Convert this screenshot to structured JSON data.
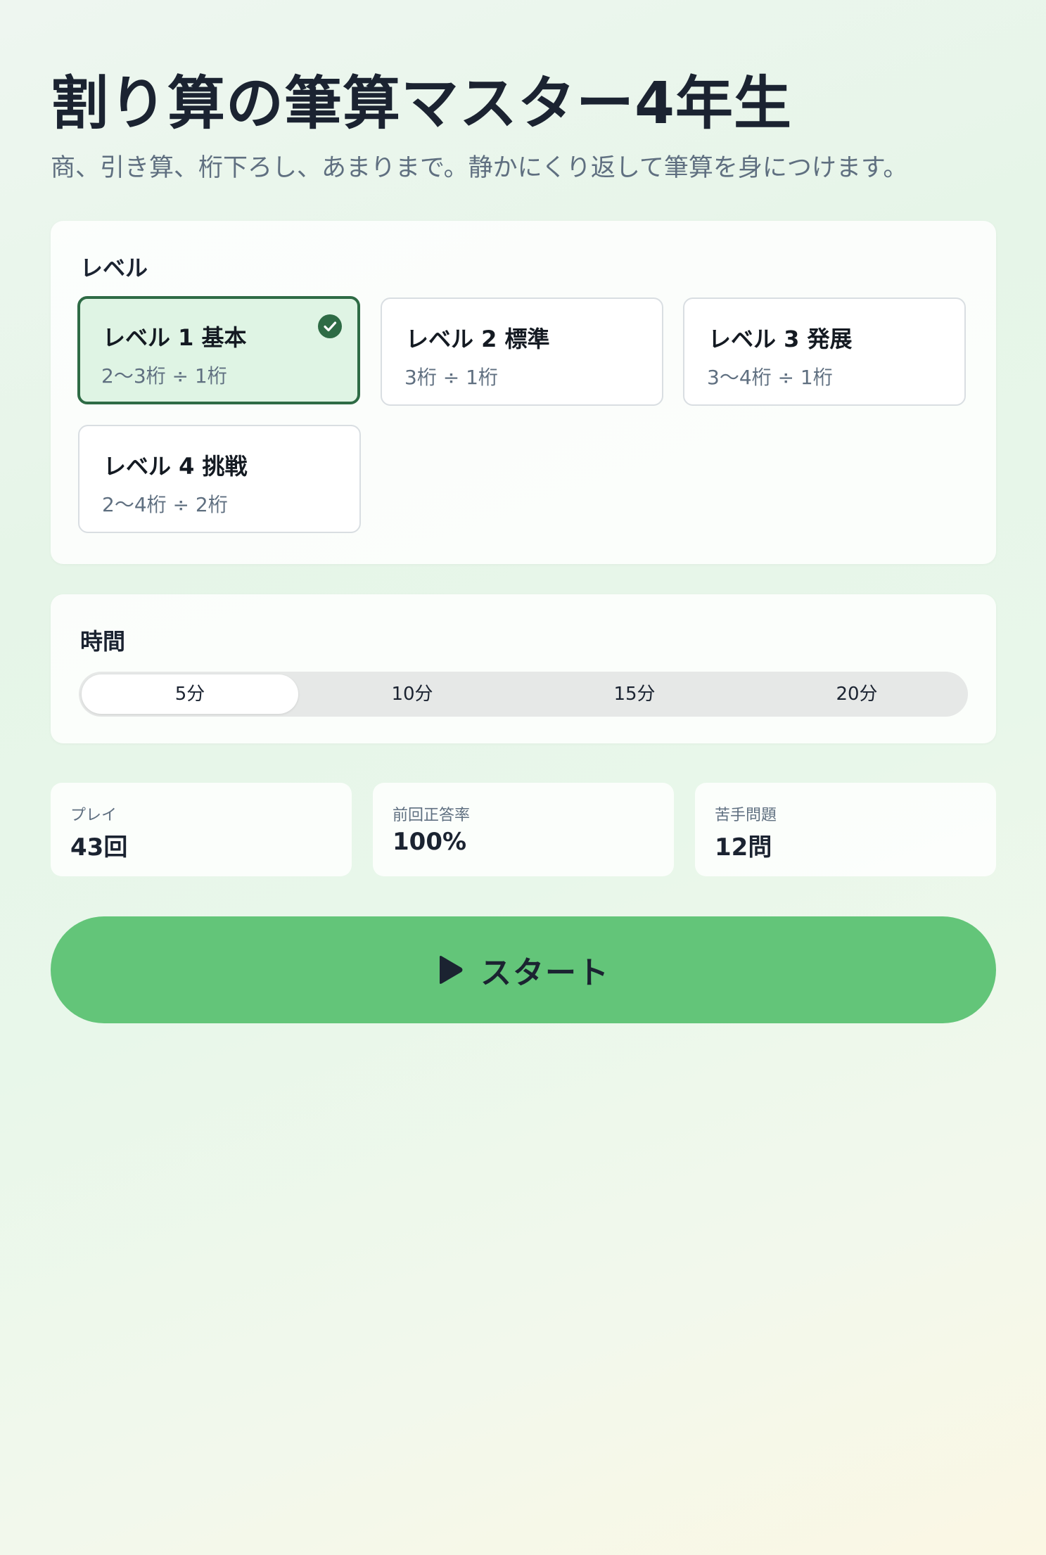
{
  "header": {
    "title": "割り算の筆算マスター4年生",
    "subtitle": "商、引き算、桁下ろし、あまりまで。静かにくり返して筆算を身につけます。"
  },
  "level_section": {
    "label": "レベル",
    "options": [
      {
        "name": "レベル 1 基本",
        "desc": "2〜3桁 ÷ 1桁",
        "selected": true
      },
      {
        "name": "レベル 2 標準",
        "desc": "3桁 ÷ 1桁",
        "selected": false
      },
      {
        "name": "レベル 3 発展",
        "desc": "3〜4桁 ÷ 1桁",
        "selected": false
      },
      {
        "name": "レベル 4 挑戦",
        "desc": "2〜4桁 ÷ 2桁",
        "selected": false
      }
    ]
  },
  "time_section": {
    "label": "時間",
    "options": [
      "5分",
      "10分",
      "15分",
      "20分"
    ],
    "selected": "5分"
  },
  "stats": [
    {
      "label": "プレイ",
      "value": "43回"
    },
    {
      "label": "前回正答率",
      "value": "100%"
    },
    {
      "label": "苦手問題",
      "value": "12問"
    }
  ],
  "start": {
    "label": "スタート",
    "icon": "play-icon"
  },
  "colors": {
    "accent": "#63c579",
    "selected_border": "#2e6b45",
    "selected_bg": "#dff4e4",
    "text_dark": "#1b2331",
    "text_muted": "#5f6f80"
  }
}
